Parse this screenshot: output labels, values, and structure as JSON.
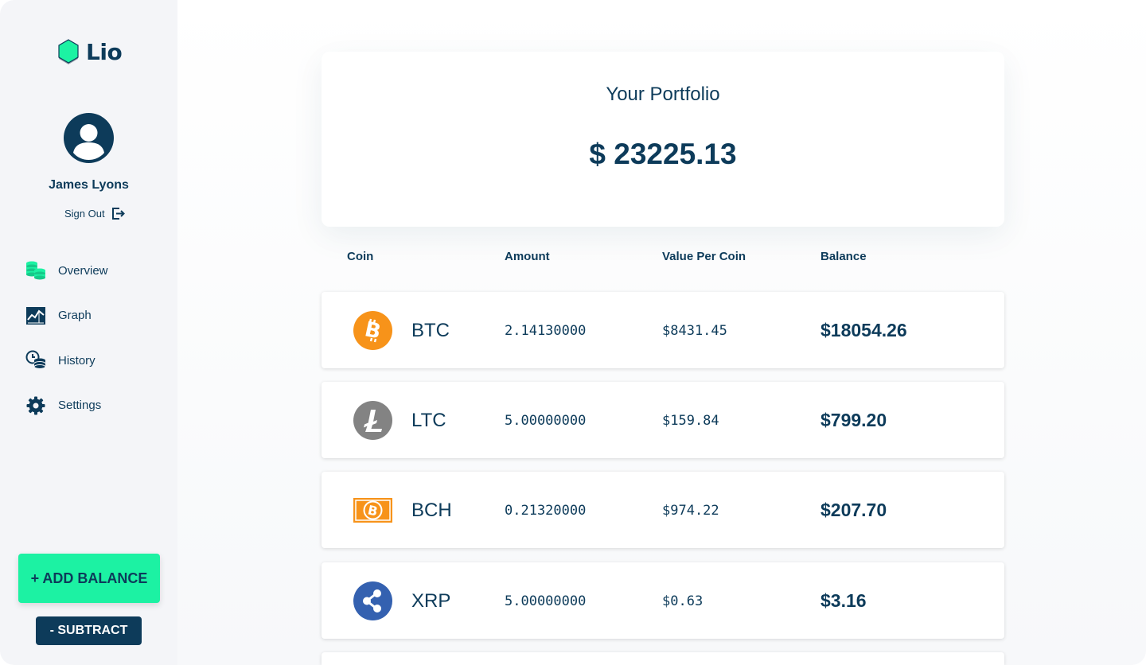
{
  "app": {
    "name": "Lio"
  },
  "user": {
    "name": "James Lyons",
    "sign_out_label": "Sign Out"
  },
  "nav": [
    {
      "label": "Overview",
      "icon": "coins-stack-icon"
    },
    {
      "label": "Graph",
      "icon": "chart-icon"
    },
    {
      "label": "History",
      "icon": "history-coins-icon"
    },
    {
      "label": "Settings",
      "icon": "gear-icon"
    }
  ],
  "actions": {
    "add_label": "+ ADD BALANCE",
    "subtract_label": "- SUBTRACT"
  },
  "portfolio": {
    "title": "Your Portfolio",
    "total": "$ 23225.13"
  },
  "table": {
    "headers": [
      "Coin",
      "Amount",
      "Value Per Coin",
      "Balance"
    ],
    "rows": [
      {
        "symbol": "BTC",
        "amount": "2.14130000",
        "value": "$8431.45",
        "balance": "$18054.26",
        "icon": "bitcoin-icon"
      },
      {
        "symbol": "LTC",
        "amount": "5.00000000",
        "value": "$159.84",
        "balance": "$799.20",
        "icon": "litecoin-icon"
      },
      {
        "symbol": "BCH",
        "amount": "0.21320000",
        "value": "$974.22",
        "balance": "$207.70",
        "icon": "bitcoin-cash-icon"
      },
      {
        "symbol": "XRP",
        "amount": "5.00000000",
        "value": "$0.63",
        "balance": "$3.16",
        "icon": "ripple-icon"
      }
    ]
  },
  "colors": {
    "primary": "#0d3b5a",
    "accent": "#1cf2a3",
    "sidebar_bg": "#f4f5f8",
    "btc": "#f7931a",
    "ltc": "#838383",
    "bch": "#f7931a",
    "xrp": "#3461b0"
  }
}
